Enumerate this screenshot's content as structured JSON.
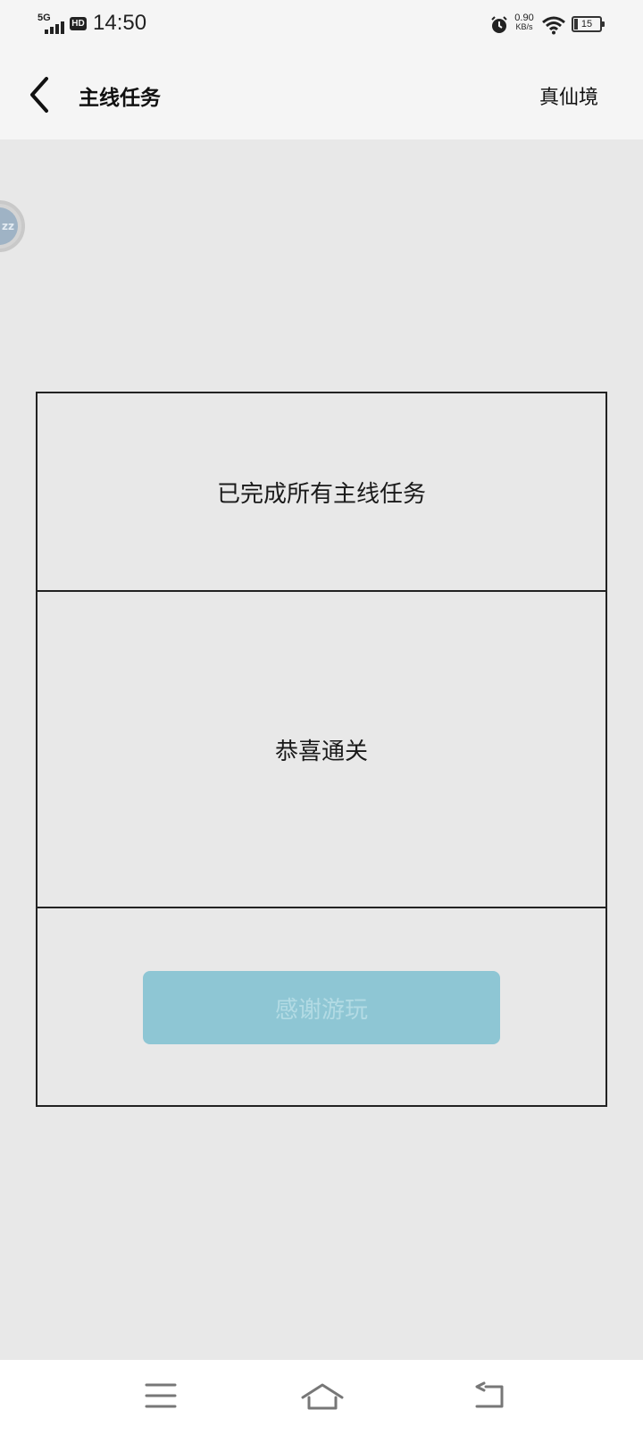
{
  "status_bar": {
    "network": "5G",
    "hd": "HD",
    "time": "14:50",
    "net_speed_value": "0.90",
    "net_speed_unit": "KB/s",
    "battery_level": "15",
    "icons": [
      "signal-bars-icon",
      "alarm-icon",
      "wifi-icon",
      "battery-icon"
    ]
  },
  "header": {
    "title": "主线任务",
    "realm": "真仙境",
    "back_icon": "chevron-left-icon"
  },
  "floating_avatar": {
    "text": "zz"
  },
  "quest_card": {
    "status_text": "已完成所有主线任务",
    "congrats_text": "恭喜通关",
    "button_label": "感谢游玩"
  },
  "bottom_nav": {
    "icons": [
      "menu-icon",
      "home-icon",
      "return-icon"
    ]
  },
  "colors": {
    "page_background": "#e8e8e8",
    "header_background": "#f5f5f5",
    "button_background": "#8ec6d4",
    "button_text": "#b3dbe4",
    "border": "#222222"
  }
}
